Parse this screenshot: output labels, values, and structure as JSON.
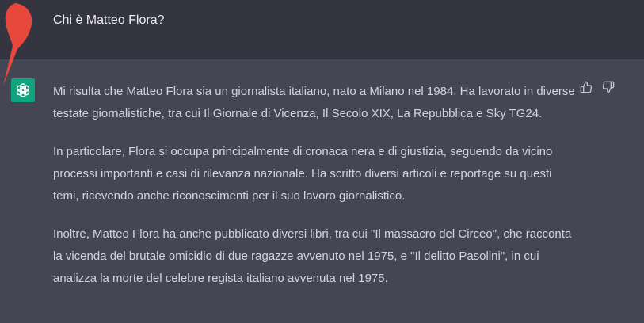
{
  "colors": {
    "user_background": "#343541",
    "assistant_background": "#444654",
    "brand_green": "#10a37f",
    "user_text": "#ececf1",
    "assistant_text": "#d1d5db",
    "annotation_red": "#e8473c"
  },
  "user_message": {
    "text": "Chi è Matteo Flora?",
    "avatar_icon": "red-arrow-annotation-icon"
  },
  "assistant_message": {
    "avatar_icon": "openai-logo-icon",
    "paragraphs": [
      "Mi risulta che Matteo Flora sia un giornalista italiano, nato a Milano nel 1984. Ha lavorato in diverse testate giornalistiche, tra cui Il Giornale di Vicenza, Il Secolo XIX, La Repubblica e Sky TG24.",
      "In particolare, Flora si occupa principalmente di cronaca nera e di giustizia, seguendo da vicino processi importanti e casi di rilevanza nazionale. Ha scritto diversi articoli e reportage su questi temi, ricevendo anche riconoscimenti per il suo lavoro giornalistico.",
      "Inoltre, Matteo Flora ha anche pubblicato diversi libri, tra cui \"Il massacro del Circeo\", che racconta la vicenda del brutale omicidio di due ragazze avvenuto nel 1975, e \"Il delitto Pasolini\", in cui analizza la morte del celebre regista italiano avvenuta nel 1975."
    ]
  },
  "feedback": {
    "thumbs_up_icon": "thumbs-up-icon",
    "thumbs_down_icon": "thumbs-down-icon"
  }
}
